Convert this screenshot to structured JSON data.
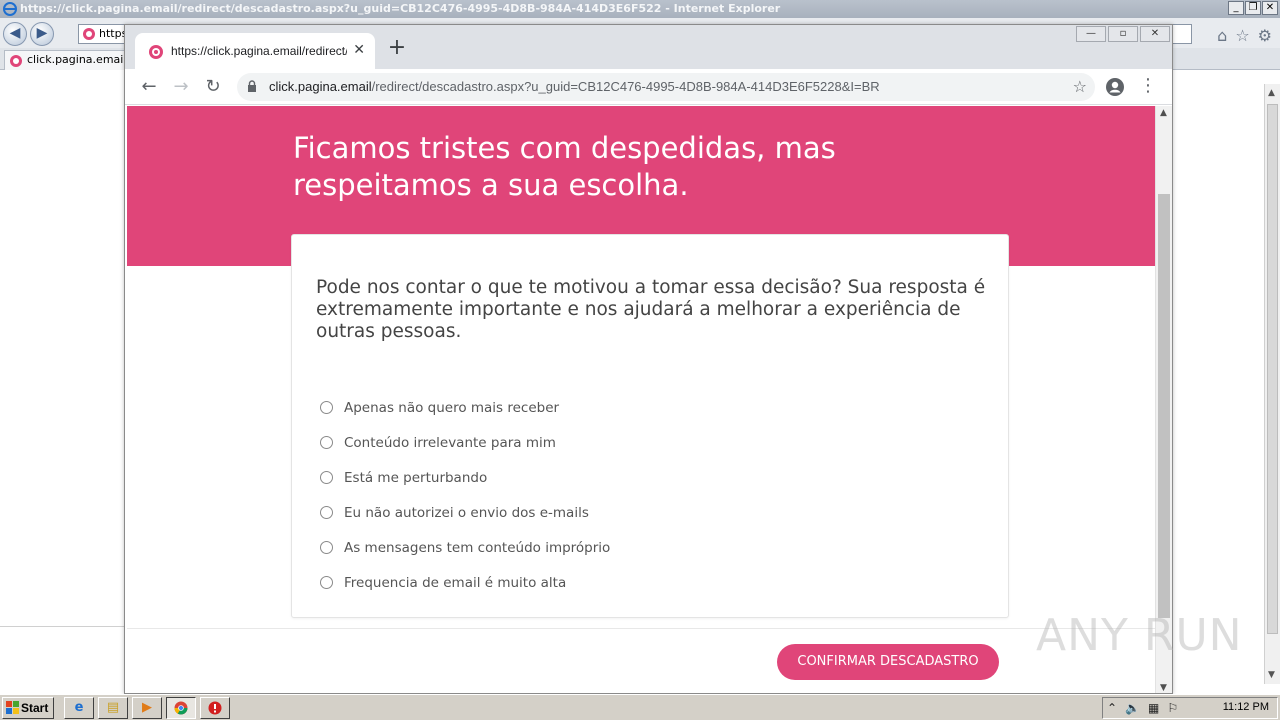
{
  "ie": {
    "title": "https://click.pagina.email/redirect/descadastro.aspx?u_guid=CB12C476-4995-4D8B-984A-414D3E6F522 - Internet Explorer",
    "address_partial": "https",
    "tab_label": "click.pagina.email"
  },
  "chrome": {
    "tab_title": "https://click.pagina.email/redirect/de",
    "url_host": "click.pagina.email",
    "url_path": "/redirect/descadastro.aspx?u_guid=CB12C476-4995-4D8B-984A-414D3E6F5228&I=BR"
  },
  "page": {
    "hero_title": "Ficamos tristes com despedidas, mas respeitamos a sua escolha.",
    "question": "Pode nos contar o que te motivou a tomar essa decisão? Sua resposta é extremamente importante e nos ajudará a melhorar a experiência de outras pessoas.",
    "options": [
      "Apenas não quero mais receber",
      "Conteúdo irrelevante para mim",
      "Está me perturbando",
      "Eu não autorizei o envio dos e-mails",
      "As mensagens tem conteúdo impróprio",
      "Frequencia de email é muito alta"
    ],
    "confirm_label": "CONFIRMAR DESCADASTRO",
    "accent_color": "#e04579"
  },
  "watermark": "ANY RUN",
  "taskbar": {
    "start_label": "Start",
    "clock": "11:12 PM"
  }
}
